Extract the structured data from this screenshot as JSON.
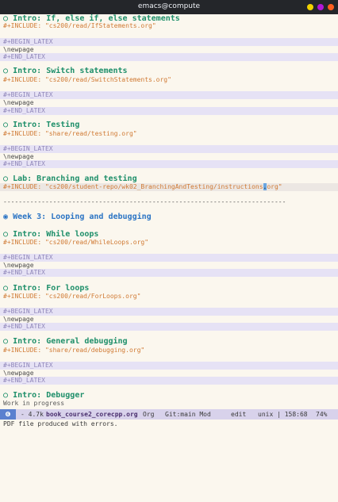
{
  "window": {
    "title": "emacs@compute",
    "buttons": {
      "minimize_color": "#f2d200",
      "maximize_color": "#b317d8",
      "close_color": "#ff5f1f"
    }
  },
  "editor": {
    "sections": [
      {
        "heading": "Intro: If, else if, else statements",
        "include": "#+INCLUDE: \"cs200/read/IfStatements.org\"",
        "begin": "#+BEGIN_LATEX",
        "newpage": "\\newpage",
        "end": "#+END_LATEX"
      },
      {
        "heading": "Intro: Switch statements",
        "include": "#+INCLUDE: \"cs200/read/SwitchStatements.org\"",
        "begin": "#+BEGIN_LATEX",
        "newpage": "\\newpage",
        "end": "#+END_LATEX"
      },
      {
        "heading": "Intro: Testing",
        "include": "#+INCLUDE: \"share/read/testing.org\"",
        "begin": "#+BEGIN_LATEX",
        "newpage": "\\newpage",
        "end": "#+END_LATEX"
      },
      {
        "heading": "Lab: Branching and testing",
        "include_before_cursor": "#+INCLUDE: \"cs200/student-repo/wk02_BranchingAndTesting/instructions",
        "cursor_char": ".",
        "include_after_cursor": "org\""
      }
    ],
    "divider": "--------------------------------------------------------------------------",
    "week": {
      "bullet": "◉",
      "heading": "Week 3: Looping and debugging"
    },
    "sections2": [
      {
        "heading": "Intro: While loops",
        "include": "#+INCLUDE: \"cs200/read/WhileLoops.org\"",
        "begin": "#+BEGIN_LATEX",
        "newpage": "\\newpage",
        "end": "#+END_LATEX"
      },
      {
        "heading": "Intro: For loops",
        "include": "#+INCLUDE: \"cs200/read/ForLoops.org\"",
        "begin": "#+BEGIN_LATEX",
        "newpage": "\\newpage",
        "end": "#+END_LATEX"
      },
      {
        "heading": "Intro: General debugging",
        "include": "#+INCLUDE: \"share/read/debugging.org\"",
        "begin": "#+BEGIN_LATEX",
        "newpage": "\\newpage",
        "end": "#+END_LATEX"
      },
      {
        "heading": "Intro: Debugger",
        "body": "Work in progress"
      }
    ],
    "heading_bullet": "○"
  },
  "modeline": {
    "badge": "❻",
    "size": "- 4.7k",
    "buffer": "book_course2_corecpp.org",
    "mode": "Org",
    "vcs": "Git:main Mod",
    "state": "edit",
    "encoding": "unix | 158:68",
    "percent": "74%"
  },
  "minibuffer": {
    "message": "PDF file produced with errors."
  }
}
